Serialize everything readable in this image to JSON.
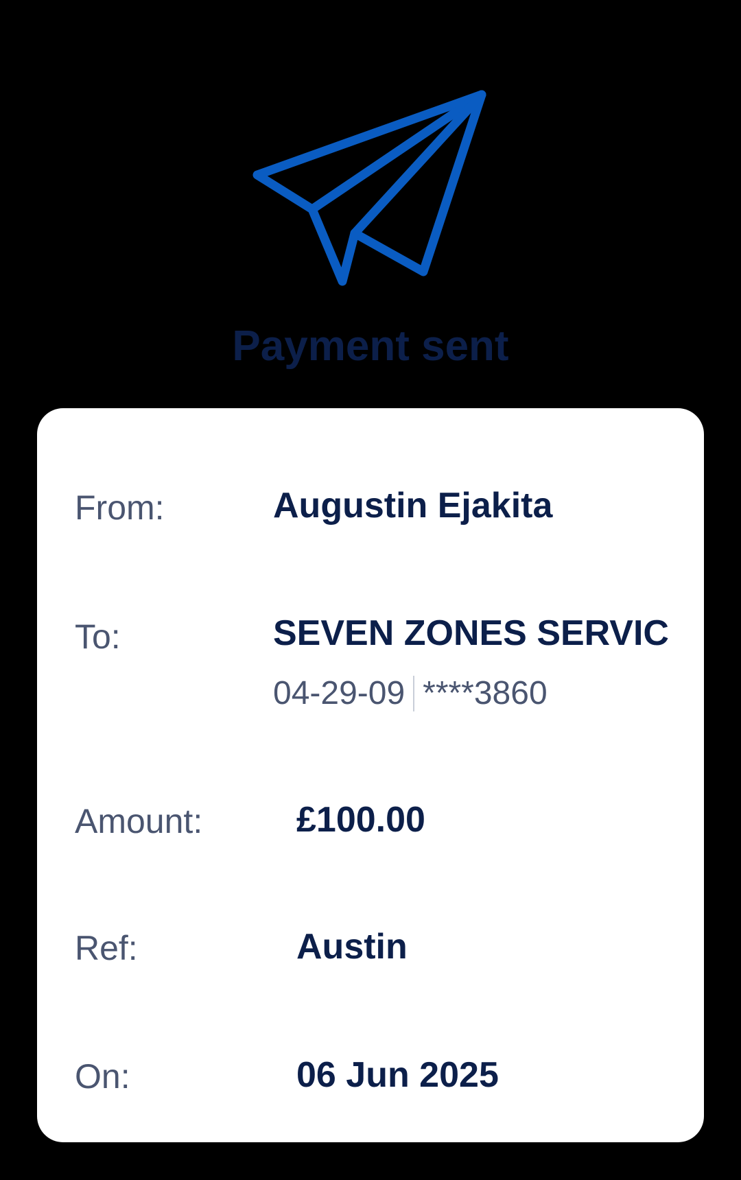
{
  "header": {
    "title": "Payment sent",
    "icon": "paper-plane-icon",
    "icon_color": "#0a5cc2",
    "title_color": "#0c1f4a"
  },
  "details": {
    "from": {
      "label": "From:",
      "value": "Augustin Ejakita"
    },
    "to": {
      "label": "To:",
      "value": "SEVEN ZONES SERVIC",
      "sort_code": "04-29-09",
      "account": "****3860"
    },
    "amount": {
      "label": "Amount:",
      "value": "£100.00"
    },
    "ref": {
      "label": "Ref:",
      "value": "Austin"
    },
    "date": {
      "label": "On:",
      "value": "06 Jun 2025"
    }
  }
}
